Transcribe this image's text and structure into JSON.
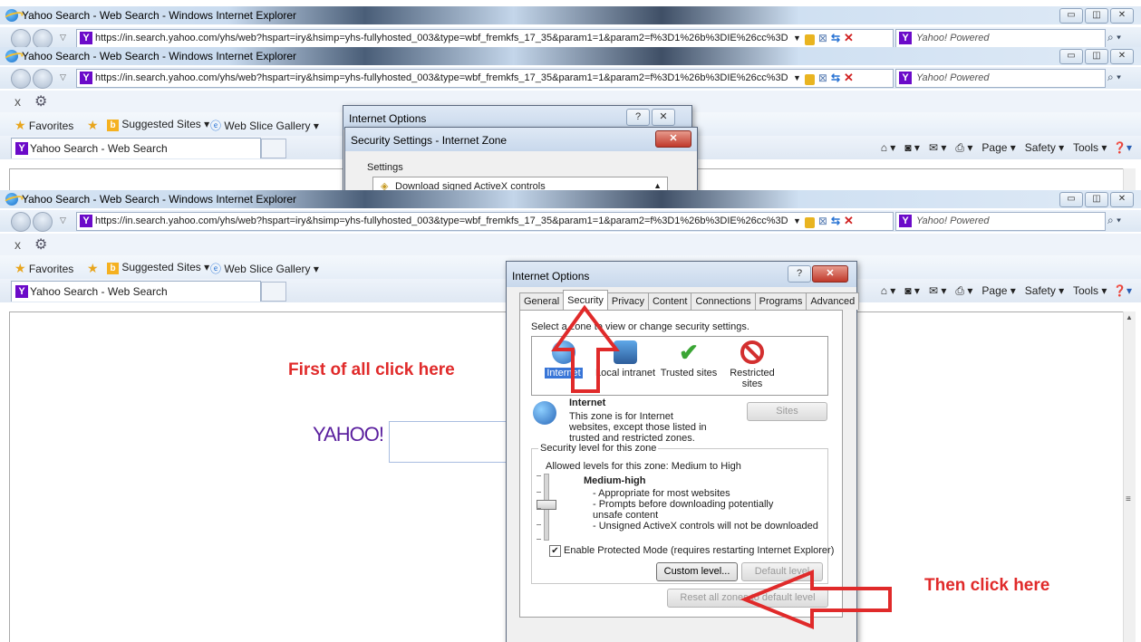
{
  "window": {
    "title": "Yahoo Search - Web Search - Windows Internet Explorer",
    "url": "https://in.search.yahoo.com/yhs/web?hspart=iry&hsimp=yhs-fullyhosted_003&type=wbf_fremkfs_17_35&param1=1&param2=f%3D1%26b%3DIE%26cc%3D",
    "search_provider": "Yahoo! Powered",
    "close_x": "x"
  },
  "favorites": {
    "favorites_label": "Favorites",
    "suggested_sites": "Suggested Sites ▾",
    "web_slice_gallery": "Web Slice Gallery ▾"
  },
  "tab": {
    "label": "Yahoo Search - Web Search"
  },
  "commands": {
    "page": "Page ▾",
    "safety": "Safety ▾",
    "tools": "Tools ▾"
  },
  "page": {
    "yahoo_logo": "YAHOO!"
  },
  "back_dialogs": {
    "internet_options_title": "Internet Options",
    "security_settings_title": "Security Settings - Internet Zone",
    "settings_label": "Settings",
    "setting_item": "Download signed ActiveX controls"
  },
  "dialog": {
    "title": "Internet Options",
    "tabs": [
      "General",
      "Security",
      "Privacy",
      "Content",
      "Connections",
      "Programs",
      "Advanced"
    ],
    "active_tab": "Security",
    "zone_prompt": "Select a zone to view or change security settings.",
    "zones": [
      "Internet",
      "Local intranet",
      "Trusted sites",
      "Restricted sites"
    ],
    "zone_title": "Internet",
    "zone_desc": "This zone is for Internet websites, except those listed in trusted and restricted zones.",
    "sites_button": "Sites",
    "security_level_label": "Security level for this zone",
    "allowed_levels": "Allowed levels for this zone: Medium to High",
    "level_name": "Medium-high",
    "level_bullets": [
      "- Appropriate for most websites",
      "- Prompts before downloading potentially unsafe content",
      "- Unsigned ActiveX controls will not be downloaded"
    ],
    "protected_mode": "Enable Protected Mode (requires restarting Internet Explorer)",
    "custom_level": "Custom level...",
    "default_level": "Default level",
    "reset_all": "Reset all zones to default level"
  },
  "annotations": {
    "first": "First of all click here",
    "then": "Then click here",
    "color": "#e02a2a"
  }
}
